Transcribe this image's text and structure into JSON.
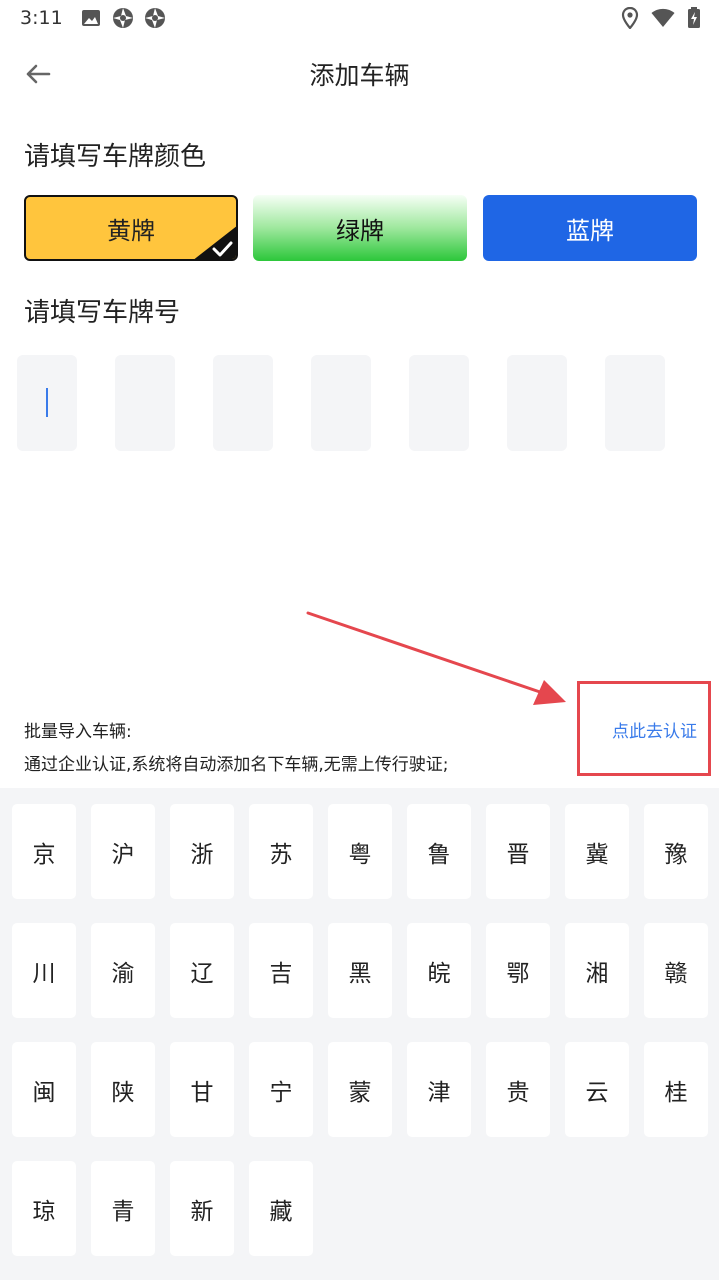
{
  "status_bar": {
    "time": "3:11"
  },
  "header": {
    "title": "添加车辆"
  },
  "plate_color": {
    "label": "请填写车牌颜色",
    "options": [
      {
        "label": "黄牌",
        "selected": true
      },
      {
        "label": "绿牌",
        "selected": false
      },
      {
        "label": "蓝牌",
        "selected": false
      }
    ]
  },
  "plate_number": {
    "label": "请填写车牌号",
    "cells": [
      "",
      "",
      "",
      "",
      "",
      "",
      ""
    ]
  },
  "batch_import": {
    "title": "批量导入车辆:",
    "description": "通过企业认证,系统将自动添加名下车辆,无需上传行驶证;",
    "link": "点此去认证"
  },
  "keyboard": {
    "keys": [
      "京",
      "沪",
      "浙",
      "苏",
      "粤",
      "鲁",
      "晋",
      "冀",
      "豫",
      "川",
      "渝",
      "辽",
      "吉",
      "黑",
      "皖",
      "鄂",
      "湘",
      "赣",
      "闽",
      "陕",
      "甘",
      "宁",
      "蒙",
      "津",
      "贵",
      "云",
      "桂",
      "琼",
      "青",
      "新",
      "藏"
    ]
  },
  "colors": {
    "accent": "#3a7bea",
    "yellow_plate": "#ffc53d",
    "blue_plate": "#1f66e5",
    "annotation": "#e5474e"
  }
}
